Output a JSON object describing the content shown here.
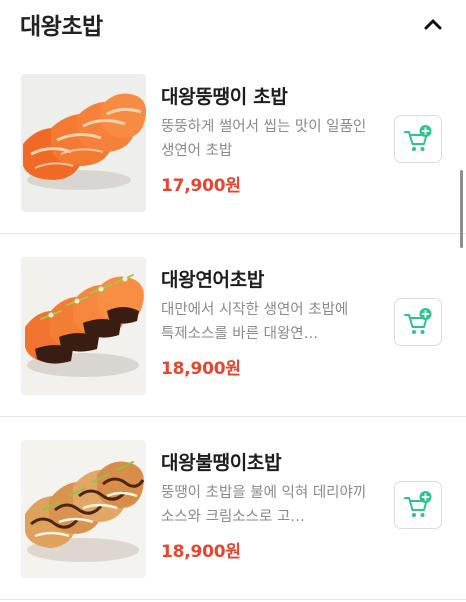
{
  "category": {
    "title": "대왕초밥"
  },
  "menu_items": [
    {
      "name": "대왕뚱땡이 초밥",
      "description": "뚱뚱하게 썰어서 씹는 맛이 일품인 생연어 초밥",
      "price": "17,900원"
    },
    {
      "name": "대왕연어초밥",
      "description": "대만에서 시작한 생연어 초밥에 특제소스를 바른 대왕연…",
      "price": "18,900원"
    },
    {
      "name": "대왕불땡이초밥",
      "description": "뚱땡이 초밥을 불에 익혀 데리야끼 소스와 크림소스로 고…",
      "price": "18,900원"
    }
  ],
  "icons": {
    "collapse": "chevron-up-icon",
    "add_to_cart": "cart-plus-icon"
  },
  "colors": {
    "price": "#e4462f",
    "accent_green": "#2fc38c",
    "title": "#1d1d1d",
    "description": "#8a8a8a"
  }
}
